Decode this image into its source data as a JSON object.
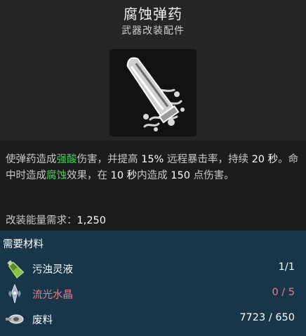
{
  "item": {
    "title": "腐蚀弹药",
    "subtitle": "武器改装配件",
    "icon": "corrosive-bullet-icon"
  },
  "description": {
    "p1": "使弹药造成",
    "h1": "强酸",
    "p2": "伤害，并提高 ",
    "n1": "15%",
    "p3": " 远程暴击率，持续 ",
    "n2": "20 秒",
    "p4": "。命中时造成",
    "h2": "腐蚀",
    "p5": "效果，在 ",
    "n3": "10 秒",
    "p6": "内造成 ",
    "n4": "150",
    "p7": " 点伤害。"
  },
  "energy": {
    "label": "改装能量需求：",
    "value": "1,250"
  },
  "materials": {
    "title": "需要材料",
    "items": [
      {
        "name": "污浊灵液",
        "count": "1/1",
        "icon": "bottle-icon",
        "sufficient": true
      },
      {
        "name": "流光水晶",
        "count": "0 / 5",
        "icon": "crystal-icon",
        "sufficient": false
      },
      {
        "name": "废料",
        "count": "7723 / 650",
        "icon": "scrap-icon",
        "sufficient": true
      }
    ]
  },
  "colors": {
    "highlight_green": "#3bd454",
    "insufficient_red": "#f07a8a",
    "materials_bg": "#17364a"
  }
}
